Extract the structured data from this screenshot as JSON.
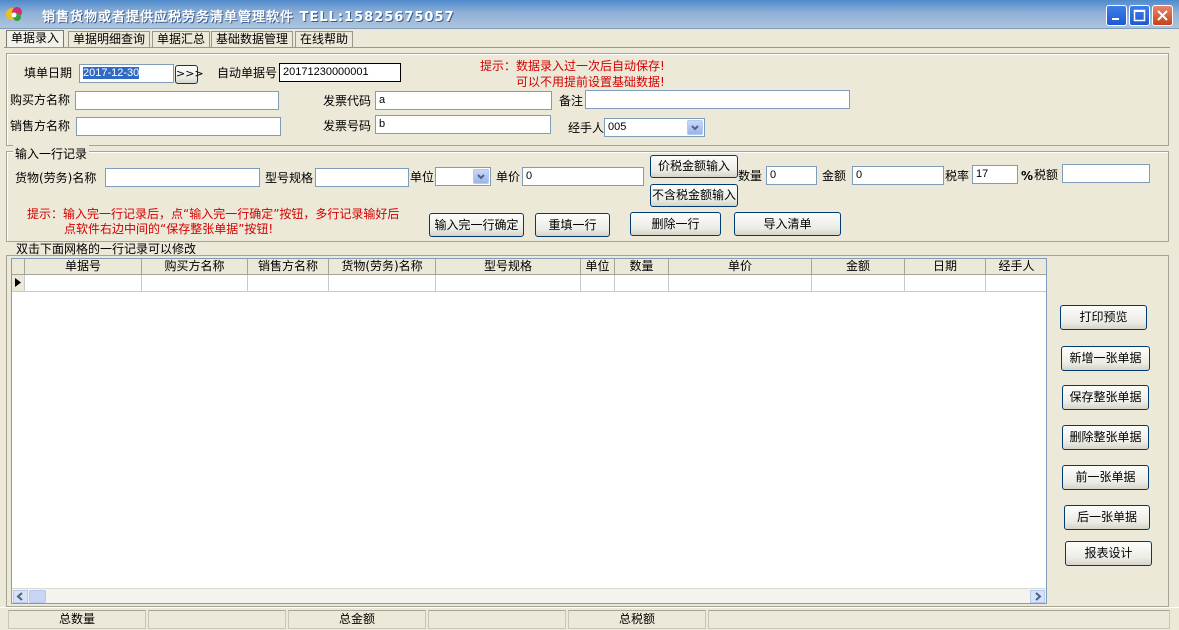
{
  "window": {
    "title": "销售货物或者提供应税劳务清单管理软件  TELL:15825675057"
  },
  "tabs": [
    "单据录入",
    "单据明细查询",
    "单据汇总",
    "基础数据管理",
    "在线帮助"
  ],
  "header": {
    "date_label": "填单日期",
    "date_value": "2017-12-30",
    "date_btn": ">>>",
    "auto_no_label": "自动单据号",
    "auto_no_value": "20171230000001",
    "hint1": "提示：数据录入过一次后自动保存!",
    "hint2": "可以不用提前设置基础数据!",
    "buyer_label": "购买方名称",
    "buyer_value": "",
    "invoice_code_label": "发票代码",
    "invoice_code_value": "a",
    "remark_label": "备注",
    "remark_value": "",
    "seller_label": "销售方名称",
    "seller_value": "",
    "invoice_no_label": "发票号码",
    "invoice_no_value": "b",
    "handler_label": "经手人",
    "handler_value": "005"
  },
  "line_entry": {
    "legend": "输入一行记录",
    "goods_label": "货物(劳务)名称",
    "goods_value": "",
    "model_label": "型号规格",
    "model_value": "",
    "unit_label": "单位",
    "unit_value": "",
    "price_label": "单价",
    "price_value": "0",
    "tax_incl_btn": "价税金额输入",
    "tax_excl_btn": "不含税金额输入",
    "qty_label": "数量",
    "qty_value": "0",
    "amount_label": "金额",
    "amount_value": "0",
    "rate_label": "税率",
    "rate_value": "17",
    "percent": "%",
    "tax_label": "税额",
    "tax_value": "",
    "tip1": "提示：输入完一行记录后，点“输入完一行确定”按钮，多行记录输好后",
    "tip2": "点软件右边中间的“保存整张单据”按钮!",
    "confirm_btn": "输入完一行确定",
    "refill_btn": "重填一行",
    "delete_row_btn": "删除一行",
    "import_btn": "导入清单"
  },
  "grid": {
    "legend": "双击下面网格的一行记录可以修改",
    "columns": [
      "单据号",
      "购买方名称",
      "销售方名称",
      "货物(劳务)名称",
      "型号规格",
      "单位",
      "数量",
      "单价",
      "金额",
      "日期",
      "经手人"
    ]
  },
  "side_buttons": [
    "打印预览",
    "新增一张单据",
    "保存整张单据",
    "删除整张单据",
    "前一张单据",
    "后一张单据",
    "报表设计"
  ],
  "statusbar": {
    "total_qty": "总数量",
    "total_amount": "总金额",
    "total_tax": "总税额"
  }
}
